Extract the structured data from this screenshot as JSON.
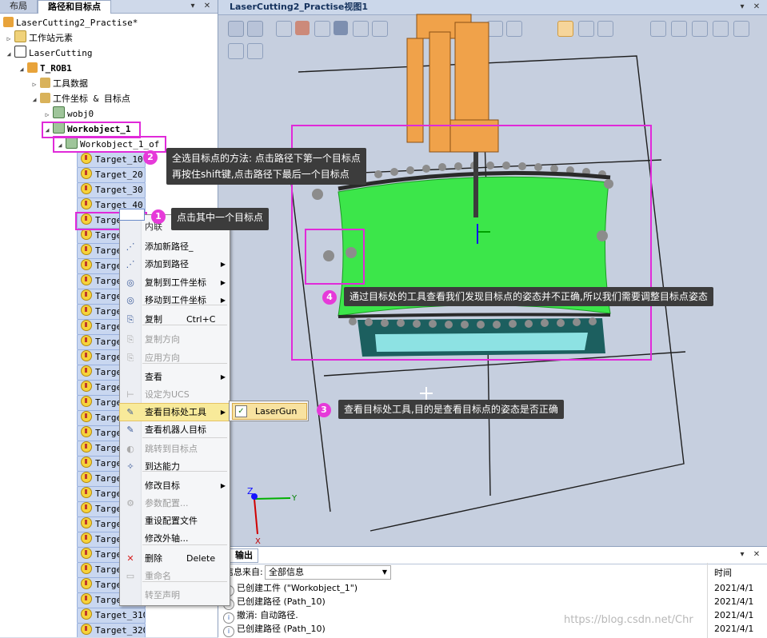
{
  "left_panel": {
    "tabs": [
      "布局",
      "路径和目标点"
    ],
    "tree": {
      "station": "LaserCutting2_Practise*",
      "station_elements": "工作站元素",
      "controller": "LaserCutting",
      "task": "T_ROB1",
      "tool_data": "工具数据",
      "wobj_and_targets": "工件坐标 & 目标点",
      "wobj0": "wobj0",
      "workobject": "Workobject_1",
      "workobject_of": "Workobject_1_of"
    },
    "targets": [
      "Target_10",
      "Target_20",
      "Target_30",
      "Target_40",
      "Targe",
      "Targe",
      "Targe",
      "Targe",
      "Targe",
      "Targe",
      "Targe",
      "Targe",
      "Targe",
      "Targe",
      "Targe",
      "Targe",
      "Targe",
      "Targe",
      "Targe",
      "Targe",
      "Targe",
      "Targe",
      "Targe",
      "Targe",
      "Targe",
      "Targe",
      "Targe",
      "Targe",
      "Targe",
      "Targe",
      "Target_310",
      "Target_320"
    ]
  },
  "context_menu": {
    "header": "内联",
    "items": [
      {
        "label": "添加新路径_",
        "icon": "path-add-icon",
        "disabled": false,
        "arrow": false,
        "shortcut": ""
      },
      {
        "label": "添加到路径",
        "icon": "path-icon",
        "disabled": false,
        "arrow": true,
        "shortcut": ""
      },
      {
        "label": "复制到工件坐标",
        "icon": "copy-wobj-icon",
        "disabled": false,
        "arrow": true,
        "shortcut": ""
      },
      {
        "label": "移动到工件坐标",
        "icon": "move-wobj-icon",
        "disabled": false,
        "arrow": true,
        "shortcut": ""
      },
      {
        "label": "复制",
        "icon": "copy-icon",
        "disabled": false,
        "arrow": false,
        "shortcut": "Ctrl+C"
      },
      {
        "label": "复制方向",
        "icon": "copy-orient-icon",
        "disabled": true,
        "arrow": false,
        "shortcut": ""
      },
      {
        "label": "应用方向",
        "icon": "apply-orient-icon",
        "disabled": true,
        "arrow": false,
        "shortcut": ""
      },
      {
        "label": "查看",
        "icon": "",
        "disabled": false,
        "arrow": true,
        "shortcut": ""
      },
      {
        "label": "设定为UCS",
        "icon": "ucs-icon",
        "disabled": true,
        "arrow": false,
        "shortcut": ""
      },
      {
        "label": "查看目标处工具",
        "icon": "tool-view-icon",
        "disabled": false,
        "arrow": true,
        "shortcut": ""
      },
      {
        "label": "查看机器人目标",
        "icon": "robot-target-icon",
        "disabled": false,
        "arrow": false,
        "shortcut": ""
      },
      {
        "label": "跳转到目标点",
        "icon": "jump-icon",
        "disabled": true,
        "arrow": false,
        "shortcut": ""
      },
      {
        "label": "到达能力",
        "icon": "reach-icon",
        "disabled": false,
        "arrow": false,
        "shortcut": ""
      },
      {
        "label": "修改目标",
        "icon": "",
        "disabled": false,
        "arrow": true,
        "shortcut": ""
      },
      {
        "label": "参数配置...",
        "icon": "config-icon",
        "disabled": true,
        "arrow": false,
        "shortcut": ""
      },
      {
        "label": "重设配置文件",
        "icon": "",
        "disabled": false,
        "arrow": false,
        "shortcut": ""
      },
      {
        "label": "修改外轴...",
        "icon": "",
        "disabled": false,
        "arrow": false,
        "shortcut": ""
      },
      {
        "label": "删除",
        "icon": "delete-icon",
        "disabled": false,
        "arrow": false,
        "shortcut": "Delete"
      },
      {
        "label": "重命名",
        "icon": "rename-icon",
        "disabled": true,
        "arrow": false,
        "shortcut": ""
      },
      {
        "label": "转至声明",
        "icon": "",
        "disabled": true,
        "arrow": false,
        "shortcut": ""
      }
    ],
    "submenu_item": "LaserGun"
  },
  "viewport": {
    "tab_title": "LaserCutting2_Practise视图1",
    "axis_labels": {
      "z": "Z",
      "x": "X",
      "y": "Y"
    }
  },
  "output": {
    "tab": "输出",
    "filter_label": "信息来自:",
    "filter_value": "全部信息",
    "time_header": "时间",
    "rows": [
      {
        "msg": "已创建工件 (\"Workobject_1\")",
        "time": "2021/4/1"
      },
      {
        "msg": "已创建路径 (Path_10)",
        "time": "2021/4/1"
      },
      {
        "msg": "撤消: 自动路径.",
        "time": "2021/4/1"
      },
      {
        "msg": "已创建路径 (Path_10)",
        "time": "2021/4/1"
      }
    ]
  },
  "callouts": {
    "c1": {
      "num": "1",
      "text": "点击其中一个目标点"
    },
    "c2": {
      "num": "2",
      "line1": "全选目标点的方法: 点击路径下第一个目标点",
      "line2": "再按住shift键,点击路径下最后一个目标点"
    },
    "c3": {
      "num": "3",
      "text": "查看目标处工具,目的是查看目标点的姿态是否正确"
    },
    "c4": {
      "num": "4",
      "text": "通过目标处的工具查看我们发现目标点的姿态并不正确,所以我们需要调整目标点姿态"
    }
  },
  "watermark": "https://blog.csdn.net/Chr"
}
